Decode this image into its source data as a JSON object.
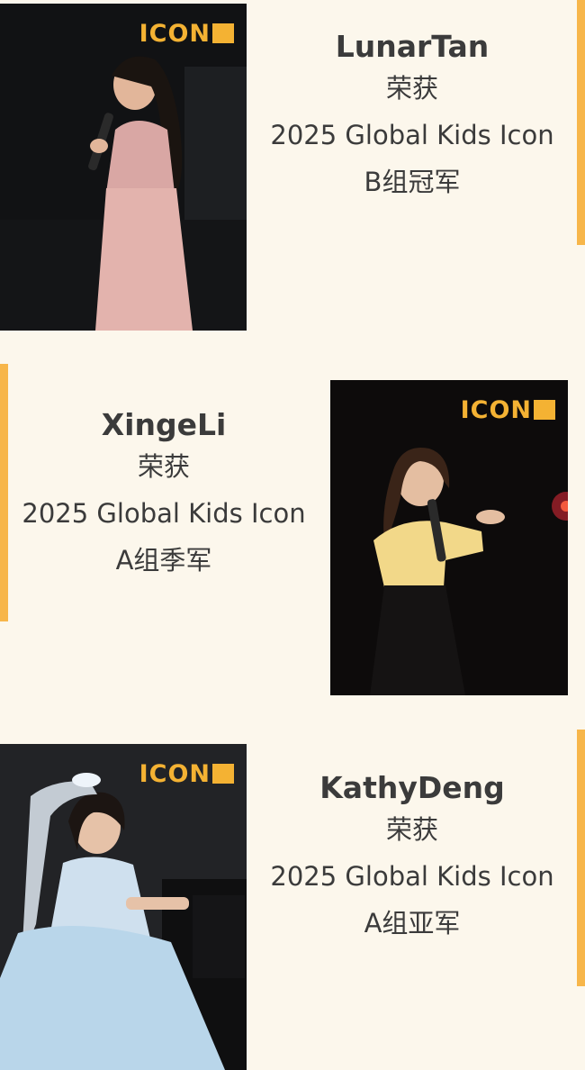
{
  "colors": {
    "background": "#fcf7ec",
    "accent": "#f7b64a",
    "logo": "#f4b233",
    "text": "#3b3b3b"
  },
  "cards": [
    {
      "name": "LunarTan",
      "award_prefix": "荣获",
      "event": "2025 Global Kids Icon",
      "result": "B组冠军",
      "photo_logo": "ICON"
    },
    {
      "name": "XingeLi",
      "award_prefix": "荣获",
      "event": "2025 Global Kids Icon",
      "result": "A组季军",
      "photo_logo": "ICON"
    },
    {
      "name": "KathyDeng",
      "award_prefix": "荣获",
      "event": "2025 Global Kids Icon",
      "result": "A组亚军",
      "photo_logo": "ICON"
    }
  ]
}
